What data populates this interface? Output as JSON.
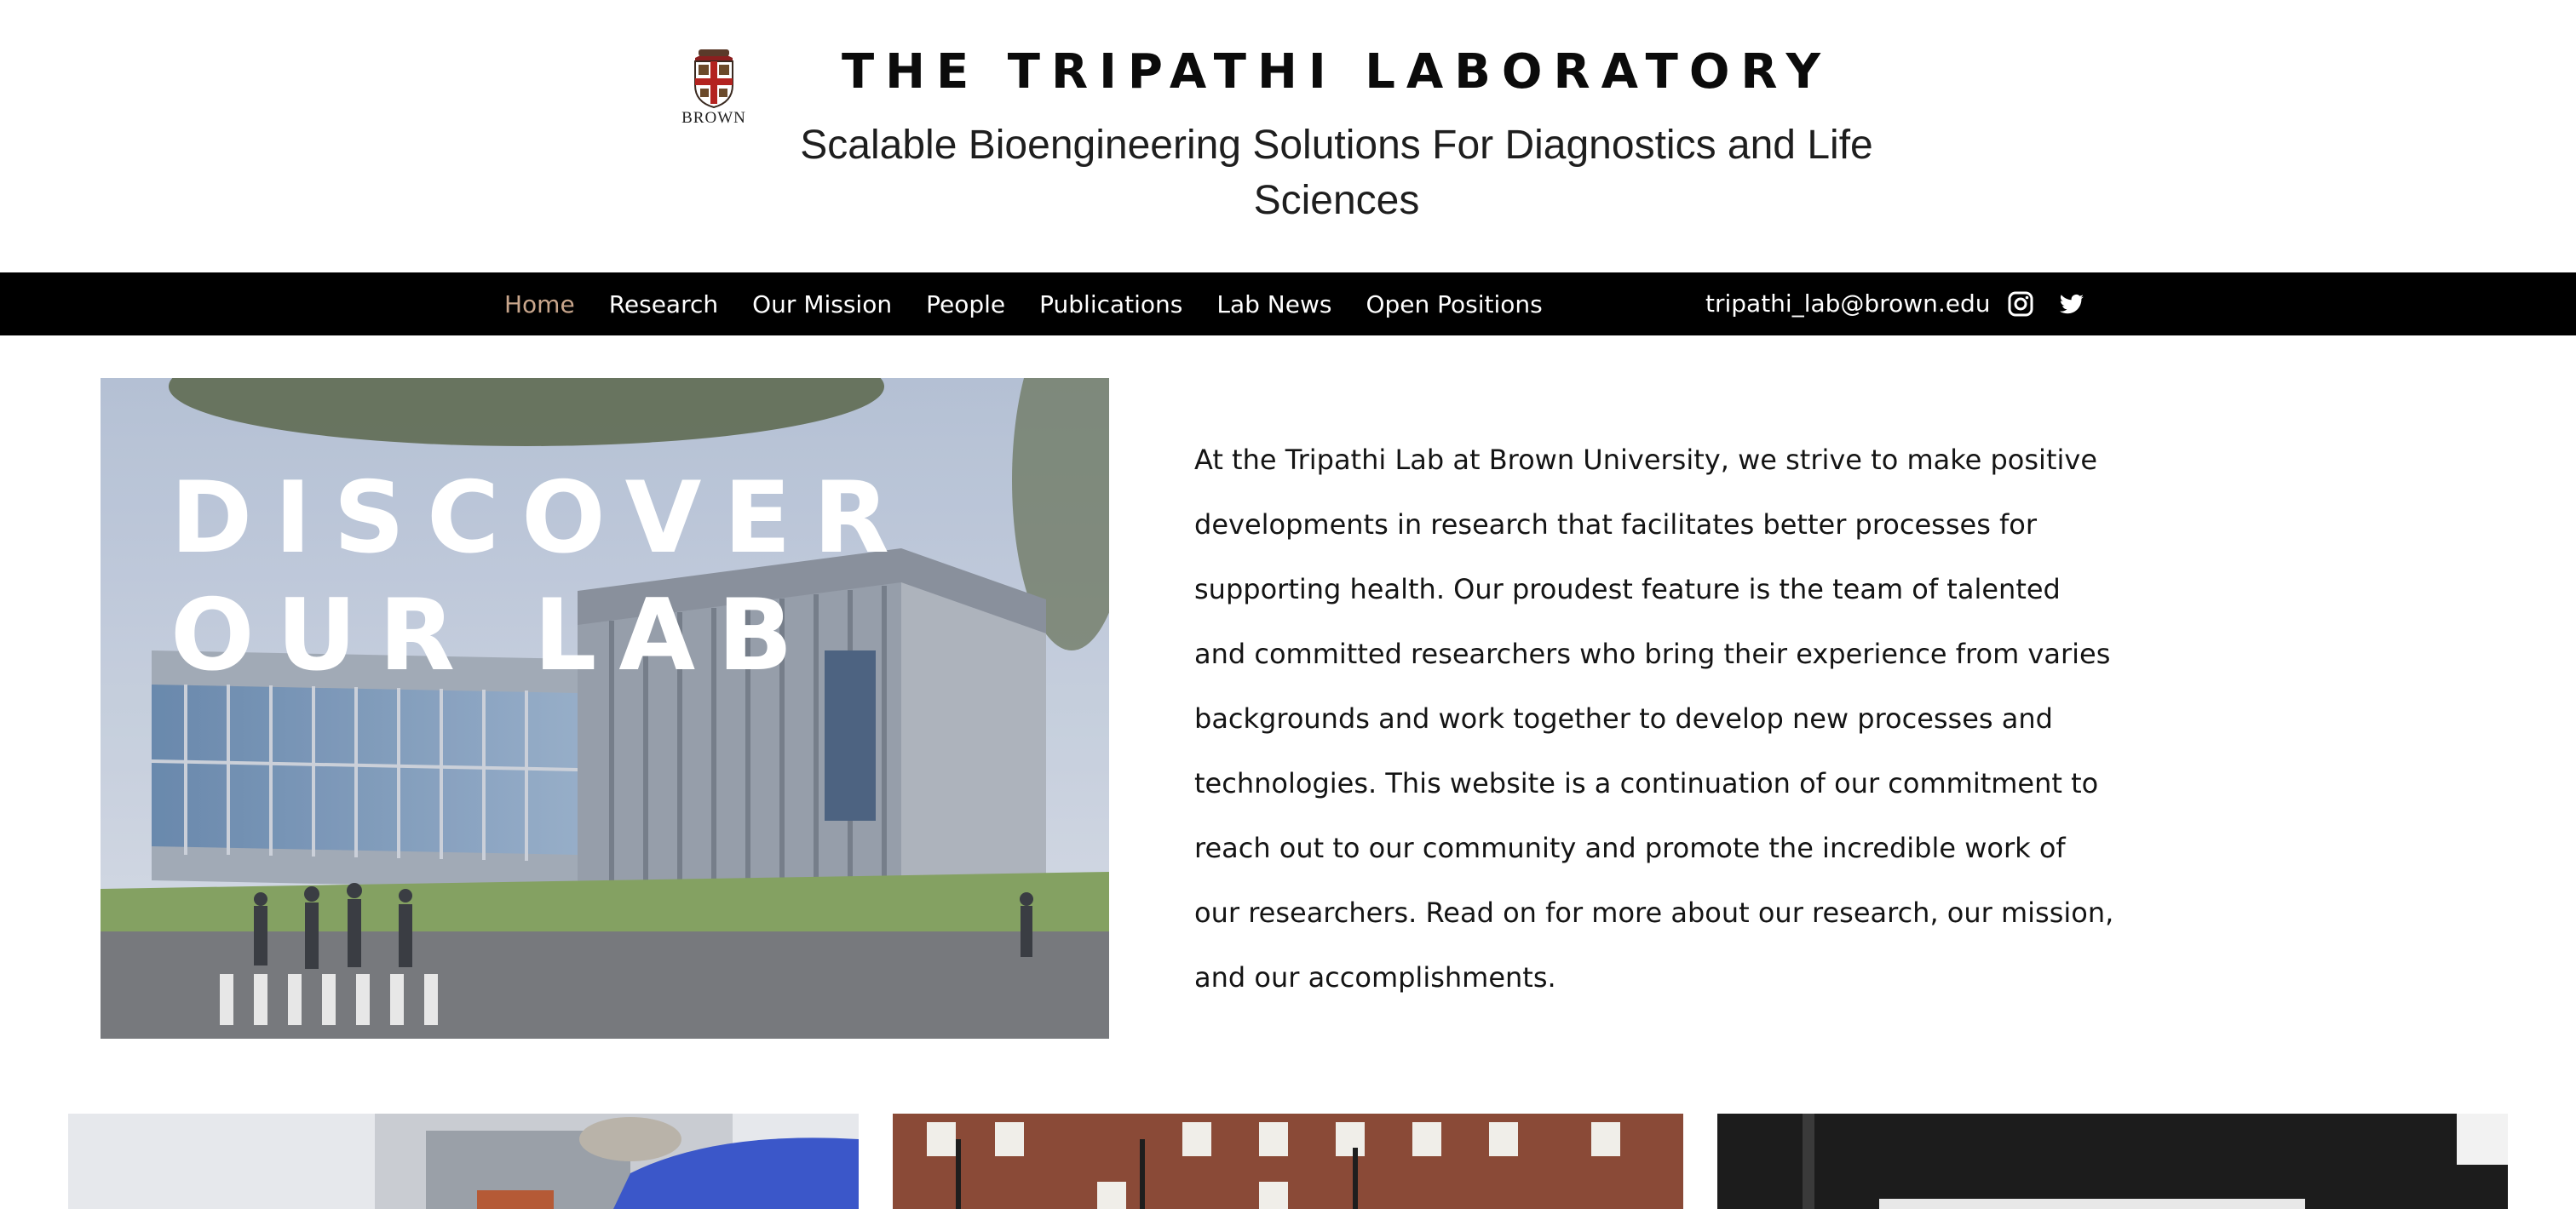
{
  "header": {
    "title": "THE TRIPATHI LABORATORY",
    "subtitle_line1": "Scalable Bioengineering Solutions For Diagnostics and Life",
    "subtitle_line2": "Sciences",
    "logo_text": "BROWN"
  },
  "nav": {
    "items": [
      {
        "label": "Home",
        "active": true
      },
      {
        "label": "Research"
      },
      {
        "label": "Our Mission"
      },
      {
        "label": "People"
      },
      {
        "label": "Publications"
      },
      {
        "label": "Lab News"
      },
      {
        "label": "Open Positions"
      }
    ],
    "email": "tripathi_lab@brown.edu",
    "social_icons": [
      "instagram-icon",
      "twitter-icon"
    ]
  },
  "hero": {
    "line1": "DISCOVER",
    "line2": "OUR LAB",
    "intro": "At the Tripathi Lab at Brown University, we strive to make positive developments in research that facilitates better processes for supporting health. Our proudest feature is the team of talented and committed researchers who bring their experience from varies backgrounds and work together to develop new processes and technologies.  This website is a continuation of our commitment to reach out to our community and promote the incredible work of our researchers. Read on for more about our research, our mission, and our accomplishments."
  },
  "gallery": {
    "items": [
      "lab-equipment-photo",
      "campus-building-photo",
      "lab-instrument-photo"
    ]
  },
  "colors": {
    "nav_bg": "#000000",
    "nav_active": "#c9a68c",
    "text": "#141414"
  }
}
